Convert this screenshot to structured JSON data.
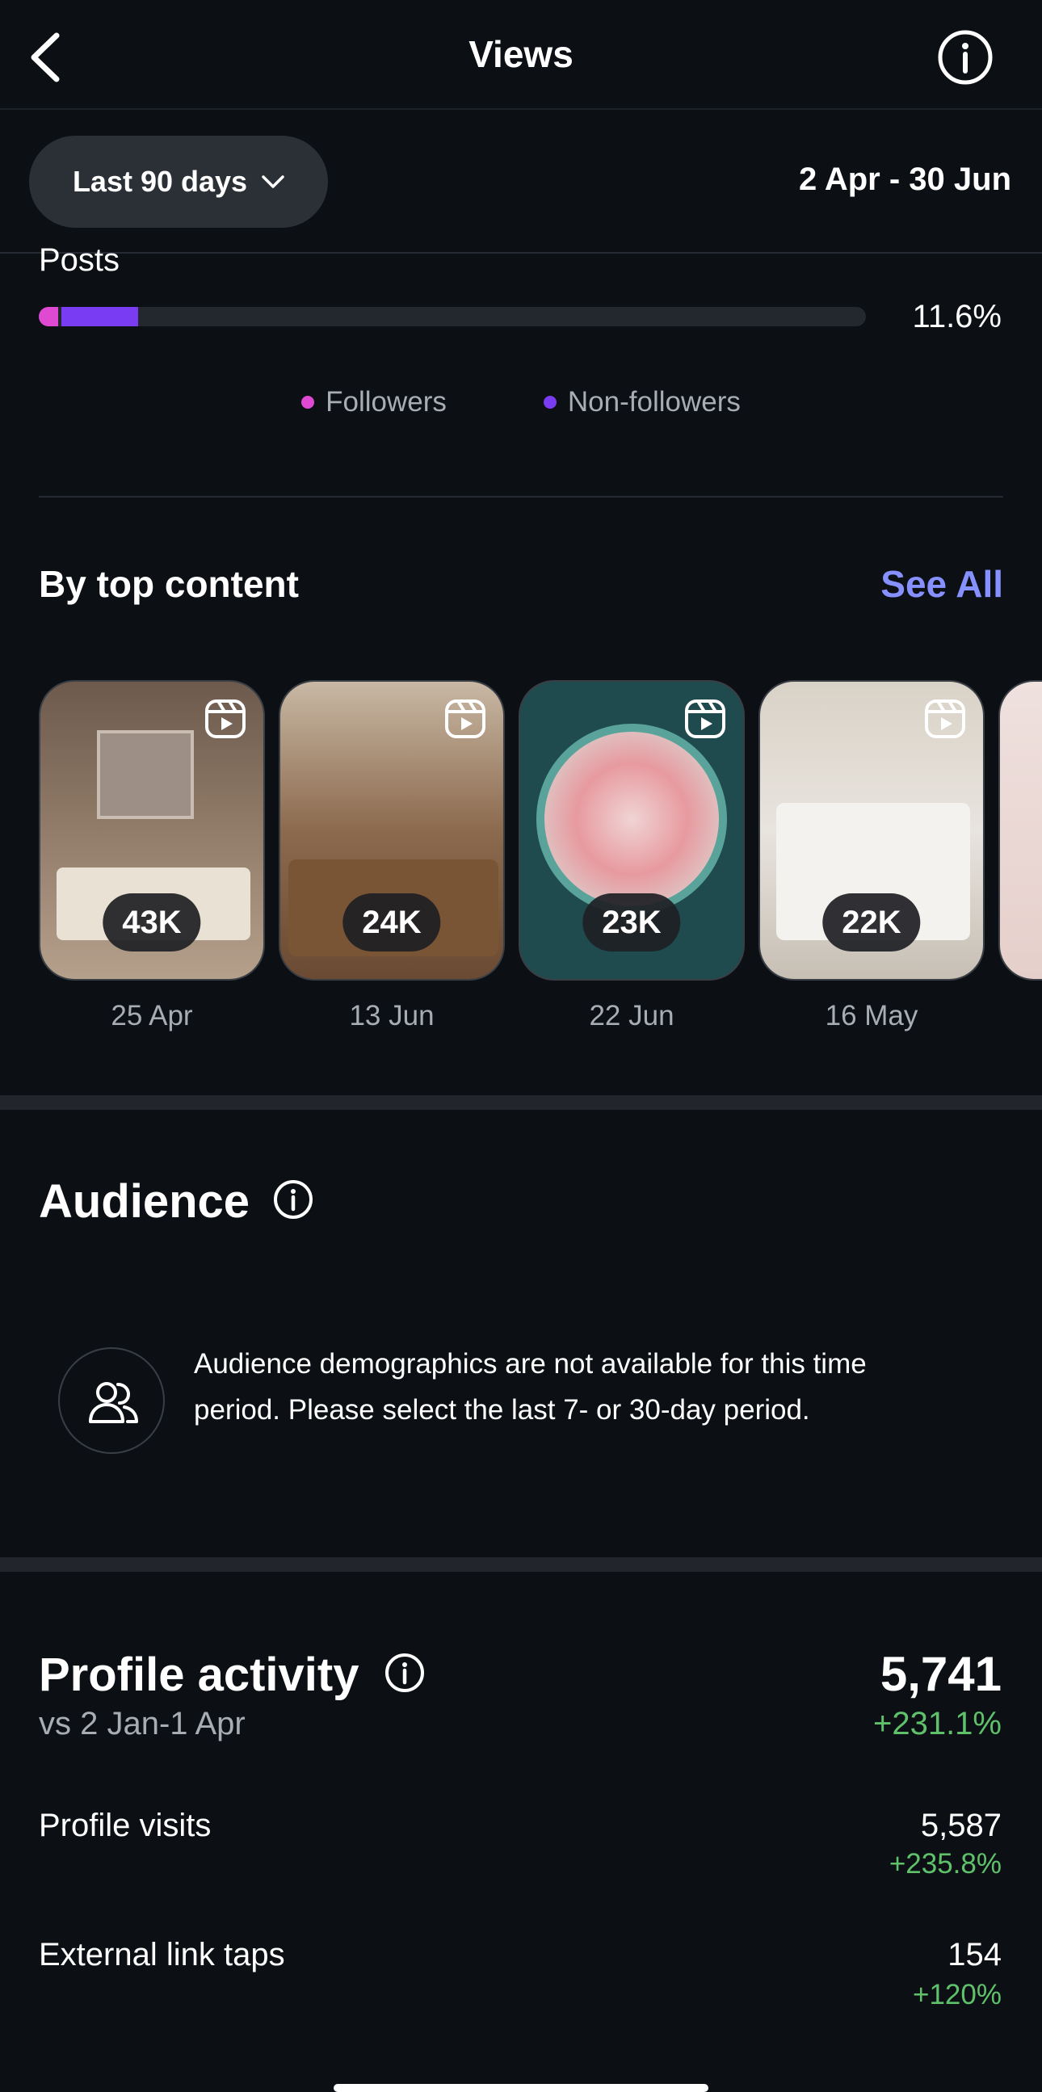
{
  "header": {
    "title": "Views"
  },
  "filter": {
    "range_label": "Last 90 days",
    "date_range": "2 Apr - 30 Jun"
  },
  "posts": {
    "label": "Posts",
    "percent": "11.6%",
    "followers_fraction": 0.023,
    "nonfollowers_fraction": 0.093
  },
  "legend": {
    "followers": "Followers",
    "non_followers": "Non-followers"
  },
  "colors": {
    "followers": "#e049d2",
    "non_followers": "#7a3cf2",
    "accent_link": "#8790ff",
    "positive": "#5fc26b"
  },
  "top_content": {
    "title": "By top content",
    "see_all": "See All",
    "items": [
      {
        "count": "43K",
        "date": "25 Apr",
        "icon": "reel-icon"
      },
      {
        "count": "24K",
        "date": "13 Jun",
        "icon": "reel-icon"
      },
      {
        "count": "23K",
        "date": "22 Jun",
        "icon": "reel-icon"
      },
      {
        "count": "22K",
        "date": "16 May",
        "icon": "reel-icon"
      }
    ]
  },
  "audience": {
    "title": "Audience",
    "message": "Audience demographics are not available for this time period. Please select the last 7- or 30-day period."
  },
  "profile_activity": {
    "title": "Profile activity",
    "compare": "vs 2 Jan-1 Apr",
    "total": "5,741",
    "total_change": "+231.1%",
    "rows": [
      {
        "label": "Profile visits",
        "value": "5,587",
        "change": "+235.8%"
      },
      {
        "label": "External link taps",
        "value": "154",
        "change": "+120%"
      }
    ]
  }
}
